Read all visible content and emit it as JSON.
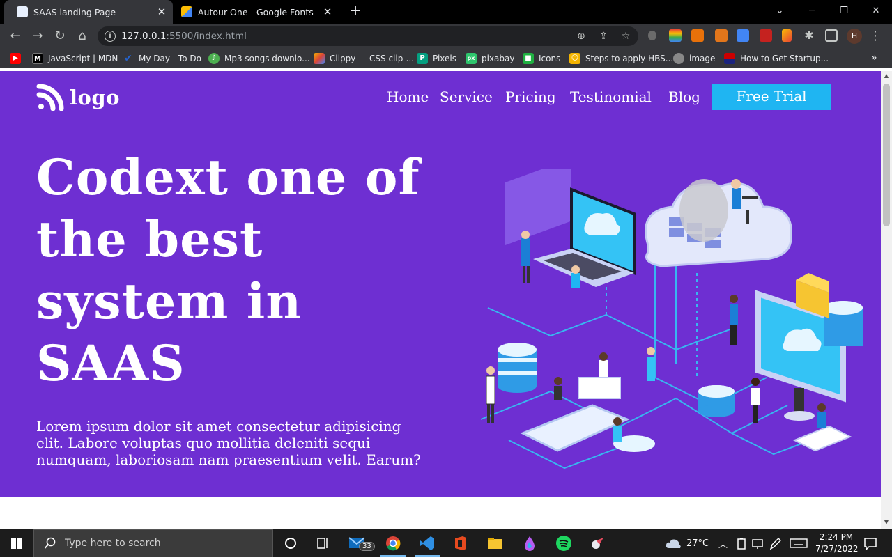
{
  "browser": {
    "tabs": [
      {
        "title": "SAAS landing Page",
        "active": true,
        "favicon_color": "#e8f0fe"
      },
      {
        "title": "Autour One - Google Fonts",
        "active": false,
        "favicon_color": "#fbbc04"
      }
    ],
    "url_host": "127.0.0.1",
    "url_path": ":5500/index.html",
    "profile_initial": "H",
    "bookmarks": [
      {
        "label": "",
        "icon": "youtube-icon",
        "color": "#ff0000"
      },
      {
        "label": "JavaScript | MDN",
        "icon": "mdn-icon",
        "color": "#000000"
      },
      {
        "label": "My Day - To Do",
        "icon": "todo-check-icon",
        "color": "#2564cf"
      },
      {
        "label": "Mp3 songs downlo...",
        "icon": "music-icon",
        "color": "#4caf50"
      },
      {
        "label": "Clippy — CSS clip-...",
        "icon": "clippy-icon",
        "color": "#f4b400"
      },
      {
        "label": "Pixels",
        "icon": "pexels-icon",
        "color": "#05a081"
      },
      {
        "label": "pixabay",
        "icon": "pixabay-icon",
        "color": "#2ec66d"
      },
      {
        "label": "Icons",
        "icon": "icons8-icon",
        "color": "#1fb141"
      },
      {
        "label": "Steps to apply HBS...",
        "icon": "bookmark-icon",
        "color": "#f4b400"
      },
      {
        "label": "image",
        "icon": "image-icon",
        "color": "#888888"
      },
      {
        "label": "How to Get Startup...",
        "icon": "startup-icon",
        "color": "#cc0000"
      }
    ]
  },
  "page": {
    "logo_text": "logo",
    "nav": [
      "Home",
      "Service",
      "Pricing",
      "Testinomial",
      "Blog"
    ],
    "cta_label": "Free Trial",
    "headline_lines": [
      "Codext one of",
      "the best",
      "system in",
      "SAAS"
    ],
    "lead": "Lorem ipsum dolor sit amet consectetur adipisicing elit. Labore voluptas quo mollitia deleniti sequi numquam, laboriosam nam praesentium velit. Earum?",
    "colors": {
      "hero_bg": "#6e2fd2",
      "cta_bg": "#1fb5f2",
      "text": "#ffffff"
    }
  },
  "taskbar": {
    "search_placeholder": "Type here to search",
    "mail_badge": "33",
    "weather": "27°C",
    "time": "2:24 PM",
    "date": "7/27/2022"
  }
}
